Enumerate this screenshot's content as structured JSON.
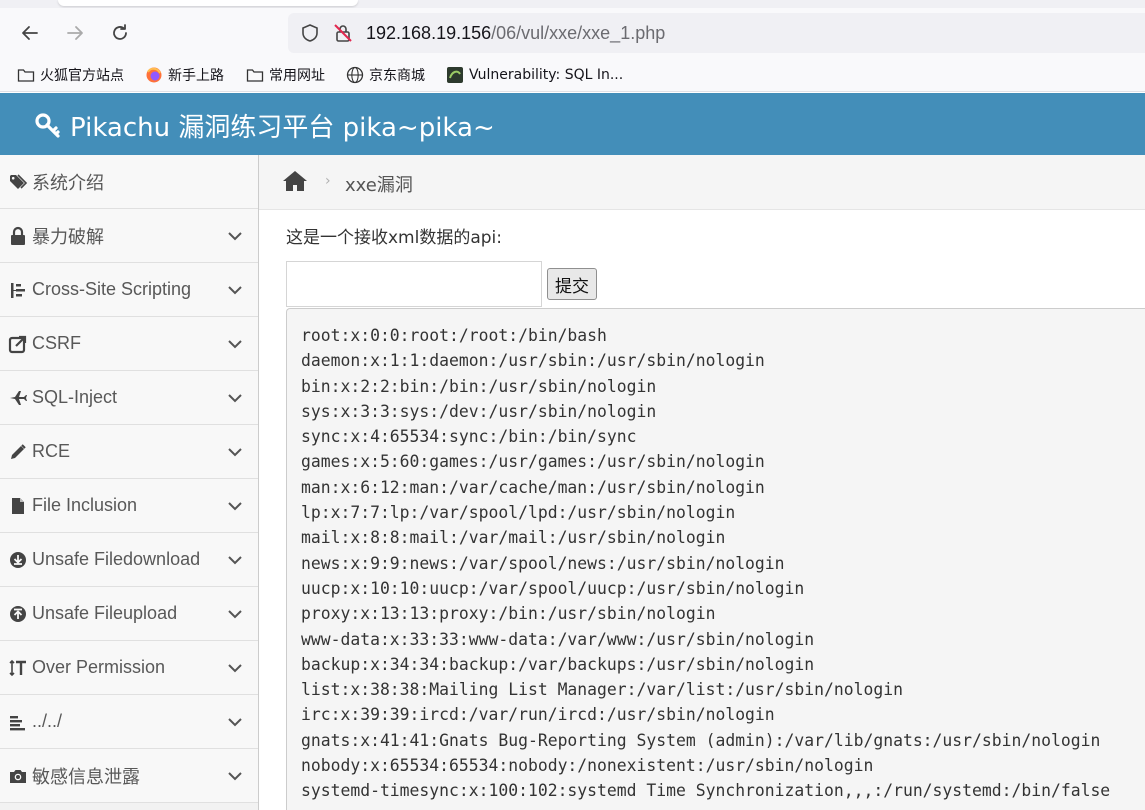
{
  "browser": {
    "url_host": "192.168.19.156",
    "url_path": "/06/vul/xxe/xxe_1.php",
    "bookmarks": [
      {
        "label": "火狐官方站点",
        "icon": "folder-icon"
      },
      {
        "label": "新手上路",
        "icon": "firefox-icon"
      },
      {
        "label": "常用网址",
        "icon": "folder-icon"
      },
      {
        "label": "京东商城",
        "icon": "globe-icon"
      },
      {
        "label": "Vulnerability: SQL In...",
        "icon": "dvwa-icon"
      }
    ]
  },
  "header": {
    "title": "Pikachu 漏洞练习平台 pika~pika~"
  },
  "sidebar": {
    "items": [
      {
        "label": "系统介绍",
        "icon": "tags-icon",
        "expandable": false
      },
      {
        "label": "暴力破解",
        "icon": "lock-icon",
        "expandable": true
      },
      {
        "label": "Cross-Site Scripting",
        "icon": "sitemap-icon",
        "expandable": true
      },
      {
        "label": "CSRF",
        "icon": "share-icon",
        "expandable": true
      },
      {
        "label": "SQL-Inject",
        "icon": "plane-icon",
        "expandable": true
      },
      {
        "label": "RCE",
        "icon": "pencil-icon",
        "expandable": true
      },
      {
        "label": "File Inclusion",
        "icon": "file-icon",
        "expandable": true
      },
      {
        "label": "Unsafe Filedownload",
        "icon": "download-icon",
        "expandable": true
      },
      {
        "label": "Unsafe Fileupload",
        "icon": "upload-icon",
        "expandable": true
      },
      {
        "label": "Over Permission",
        "icon": "text-height-icon",
        "expandable": true
      },
      {
        "label": "../../",
        "icon": "align-icon",
        "expandable": true
      },
      {
        "label": "敏感信息泄露",
        "icon": "camera-icon",
        "expandable": true
      }
    ]
  },
  "breadcrumb": {
    "current": "xxe漏洞"
  },
  "main": {
    "prompt": "这是一个接收xml数据的api:",
    "input_value": "",
    "submit_label": "提交",
    "output_lines": [
      "root:x:0:0:root:/root:/bin/bash",
      "daemon:x:1:1:daemon:/usr/sbin:/usr/sbin/nologin",
      "bin:x:2:2:bin:/bin:/usr/sbin/nologin",
      "sys:x:3:3:sys:/dev:/usr/sbin/nologin",
      "sync:x:4:65534:sync:/bin:/bin/sync",
      "games:x:5:60:games:/usr/games:/usr/sbin/nologin",
      "man:x:6:12:man:/var/cache/man:/usr/sbin/nologin",
      "lp:x:7:7:lp:/var/spool/lpd:/usr/sbin/nologin",
      "mail:x:8:8:mail:/var/mail:/usr/sbin/nologin",
      "news:x:9:9:news:/var/spool/news:/usr/sbin/nologin",
      "uucp:x:10:10:uucp:/var/spool/uucp:/usr/sbin/nologin",
      "proxy:x:13:13:proxy:/bin:/usr/sbin/nologin",
      "www-data:x:33:33:www-data:/var/www:/usr/sbin/nologin",
      "backup:x:34:34:backup:/var/backups:/usr/sbin/nologin",
      "list:x:38:38:Mailing List Manager:/var/list:/usr/sbin/nologin",
      "irc:x:39:39:ircd:/var/run/ircd:/usr/sbin/nologin",
      "gnats:x:41:41:Gnats Bug-Reporting System (admin):/var/lib/gnats:/usr/sbin/nologin",
      "nobody:x:65534:65534:nobody:/nonexistent:/usr/sbin/nologin",
      "systemd-timesync:x:100:102:systemd Time Synchronization,,,:/run/systemd:/bin/false"
    ]
  }
}
